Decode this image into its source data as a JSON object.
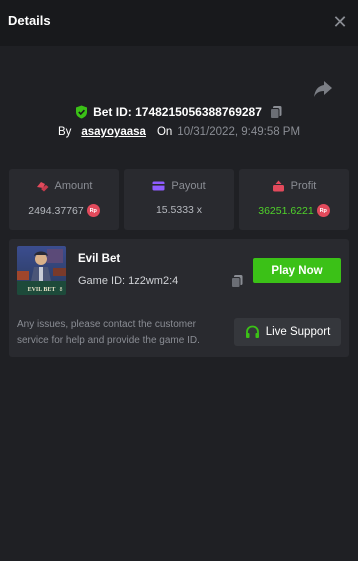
{
  "header": {
    "title": "Details",
    "close_icon": "close-icon"
  },
  "bet": {
    "id_label": "Bet ID: 1748215056388769287",
    "by_label": "By",
    "user": "asayoyaasa",
    "on_label": "On",
    "datetime": "10/31/2022, 9:49:58 PM",
    "share_icon": "share-icon",
    "shield_icon": "shield-check-icon",
    "copy_icon": "copy-icon"
  },
  "stats": [
    {
      "label": "Amount",
      "value": "2494.37767",
      "badge": "Rp",
      "icon": "coins-icon",
      "icon_color": "#e24a5c",
      "value_color": "#b5b8be"
    },
    {
      "label": "Payout",
      "value": "15.5333 x",
      "badge": "",
      "icon": "card-icon",
      "icon_color": "#8f5cff",
      "value_color": "#b5b8be"
    },
    {
      "label": "Profit",
      "value": "36251.6221",
      "badge": "Rp",
      "icon": "profit-icon",
      "icon_color": "#e24a5c",
      "value_color": "#4fd12a"
    }
  ],
  "game": {
    "name": "Evil Bet",
    "id_label": "Game ID: 1z2wm2:4",
    "thumb_text": "EVIL BET",
    "thumb_badge": "8",
    "play_label": "Play Now"
  },
  "support": {
    "message": "Any issues, please contact the customer service for help and provide the game ID.",
    "button_label": "Live Support",
    "icon": "headset-icon"
  },
  "colors": {
    "background": "#1f2024",
    "header": "#18191c",
    "card": "#292a2f",
    "accent_green": "#3bc117",
    "profit_green": "#4fd12a",
    "muted": "#8a8d94"
  }
}
